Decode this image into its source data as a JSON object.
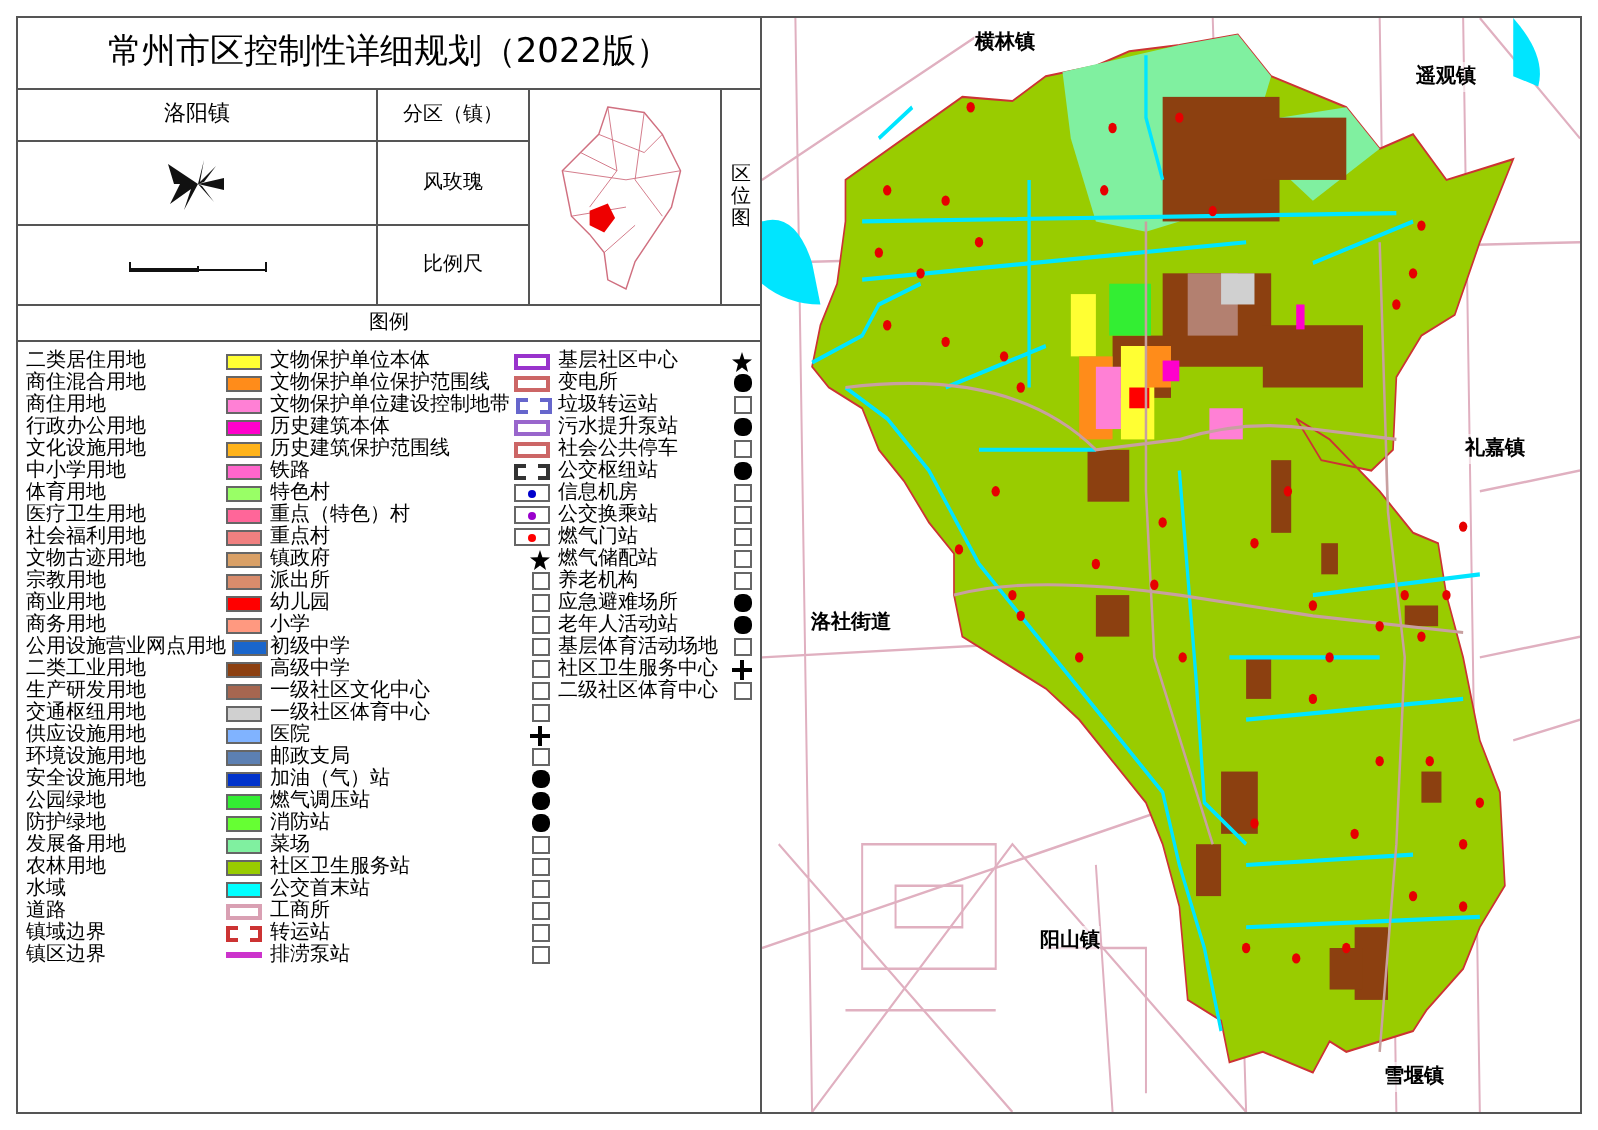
{
  "title": "常州市区控制性详细规划（2022版）",
  "info": {
    "district_label": "分区（镇）",
    "district_value": "洛阳镇",
    "wind_rose_label": "风玫瑰",
    "scale_label": "比例尺",
    "location_label": "区位图"
  },
  "legend": {
    "title": "图例",
    "columns": [
      [
        {
          "label": "二类居住用地",
          "kind": "fill",
          "color": "#ffff33"
        },
        {
          "label": "商住混合用地",
          "kind": "fill",
          "color": "#ff8c1a"
        },
        {
          "label": "商住用地",
          "kind": "fill",
          "color": "#ff80d5"
        },
        {
          "label": "行政办公用地",
          "kind": "fill",
          "color": "#ff00cc"
        },
        {
          "label": "文化设施用地",
          "kind": "fill",
          "color": "#ffb31a"
        },
        {
          "label": "中小学用地",
          "kind": "fill",
          "color": "#ff66cc"
        },
        {
          "label": "体育用地",
          "kind": "fill",
          "color": "#99ff66"
        },
        {
          "label": "医疗卫生用地",
          "kind": "fill",
          "color": "#ff6699"
        },
        {
          "label": "社会福利用地",
          "kind": "fill",
          "color": "#f08080"
        },
        {
          "label": "文物古迹用地",
          "kind": "fill",
          "color": "#d9a066"
        },
        {
          "label": "宗教用地",
          "kind": "fill",
          "color": "#d98c6c"
        },
        {
          "label": "商业用地",
          "kind": "fill",
          "color": "#ff0000"
        },
        {
          "label": "商务用地",
          "kind": "fill",
          "color": "#ff9980"
        },
        {
          "label": "公用设施营业网点用地",
          "kind": "fill",
          "color": "#1a66cc"
        },
        {
          "label": "二类工业用地",
          "kind": "fill",
          "color": "#8c4010"
        },
        {
          "label": "生产研发用地",
          "kind": "fill",
          "color": "#a66650"
        },
        {
          "label": "交通枢纽用地",
          "kind": "fill",
          "color": "#d0d0d0"
        },
        {
          "label": "供应设施用地",
          "kind": "fill",
          "color": "#80b3ff"
        },
        {
          "label": "环境设施用地",
          "kind": "fill",
          "color": "#5c80b3"
        },
        {
          "label": "安全设施用地",
          "kind": "fill",
          "color": "#0033cc"
        },
        {
          "label": "公园绿地",
          "kind": "fill",
          "color": "#33ee33"
        },
        {
          "label": "防护绿地",
          "kind": "fill",
          "color": "#66ff33"
        },
        {
          "label": "发展备用地",
          "kind": "fill",
          "color": "#80f0a0"
        },
        {
          "label": "农林用地",
          "kind": "fill",
          "color": "#99cc00"
        },
        {
          "label": "水域",
          "kind": "fill",
          "color": "#00ffff"
        },
        {
          "label": "道路",
          "kind": "outline",
          "color": "#d9a0b3"
        },
        {
          "label": "镇域边界",
          "kind": "dashed",
          "color": "#cc3333"
        },
        {
          "label": "镇区边界",
          "kind": "line",
          "color": "#cc33cc"
        }
      ],
      [
        {
          "label": "文物保护单位本体",
          "kind": "outline",
          "color": "#9933cc"
        },
        {
          "label": "文物保护单位保护范围线",
          "kind": "outline",
          "color": "#cc6666"
        },
        {
          "label": "文物保护单位建设控制地带",
          "kind": "dashed",
          "color": "#6666cc"
        },
        {
          "label": "历史建筑本体",
          "kind": "outline",
          "color": "#9966cc"
        },
        {
          "label": "历史建筑保护范围线",
          "kind": "outline",
          "color": "#cc6666"
        },
        {
          "label": "铁路",
          "kind": "dashed",
          "color": "#333333"
        },
        {
          "label": "特色村",
          "kind": "dot",
          "color": "#0000cc"
        },
        {
          "label": "重点（特色）村",
          "kind": "dot",
          "color": "#9900cc"
        },
        {
          "label": "重点村",
          "kind": "dot",
          "color": "#ff0000"
        },
        {
          "label": "镇政府",
          "kind": "star",
          "color": "#000000"
        },
        {
          "label": "派出所",
          "kind": "symbol",
          "color": "#666666"
        },
        {
          "label": "幼儿园",
          "kind": "symbol",
          "color": "#666666"
        },
        {
          "label": "小学",
          "kind": "symbol",
          "color": "#666666"
        },
        {
          "label": "初级中学",
          "kind": "symbol",
          "color": "#666666"
        },
        {
          "label": "高级中学",
          "kind": "symbol",
          "color": "#666666"
        },
        {
          "label": "一级社区文化中心",
          "kind": "symbol",
          "color": "#666666"
        },
        {
          "label": "一级社区体育中心",
          "kind": "symbol",
          "color": "#666666"
        },
        {
          "label": "医院",
          "kind": "cross",
          "color": "#000000"
        },
        {
          "label": "邮政支局",
          "kind": "symbol",
          "color": "#666666"
        },
        {
          "label": "加油（气）站",
          "kind": "solid",
          "color": "#000000"
        },
        {
          "label": "燃气调压站",
          "kind": "solid",
          "color": "#000000"
        },
        {
          "label": "消防站",
          "kind": "solid",
          "color": "#000000"
        },
        {
          "label": "菜场",
          "kind": "symbol",
          "color": "#666666"
        },
        {
          "label": "社区卫生服务站",
          "kind": "symbol",
          "color": "#666666"
        },
        {
          "label": "公交首末站",
          "kind": "symbol",
          "color": "#666666"
        },
        {
          "label": "工商所",
          "kind": "symbol",
          "color": "#666666"
        },
        {
          "label": "转运站",
          "kind": "symbol",
          "color": "#666666"
        },
        {
          "label": "排涝泵站",
          "kind": "symbol",
          "color": "#666666"
        }
      ],
      [
        {
          "label": "基层社区中心",
          "kind": "star",
          "color": "#000000"
        },
        {
          "label": "变电所",
          "kind": "solid",
          "color": "#000000"
        },
        {
          "label": "垃圾转运站",
          "kind": "symbol",
          "color": "#666666"
        },
        {
          "label": "污水提升泵站",
          "kind": "solid",
          "color": "#000000"
        },
        {
          "label": "社会公共停车",
          "kind": "symbol",
          "color": "#666666"
        },
        {
          "label": "公交枢纽站",
          "kind": "solid",
          "color": "#000000"
        },
        {
          "label": "信息机房",
          "kind": "symbol",
          "color": "#666666"
        },
        {
          "label": "公交换乘站",
          "kind": "symbol",
          "color": "#666666"
        },
        {
          "label": "燃气门站",
          "kind": "symbol",
          "color": "#666666"
        },
        {
          "label": "燃气储配站",
          "kind": "symbol",
          "color": "#666666"
        },
        {
          "label": "养老机构",
          "kind": "symbol",
          "color": "#666666"
        },
        {
          "label": "应急避难场所",
          "kind": "solid",
          "color": "#000000"
        },
        {
          "label": "老年人活动站",
          "kind": "solid",
          "color": "#000000"
        },
        {
          "label": "基层体育活动场地",
          "kind": "symbol",
          "color": "#666666"
        },
        {
          "label": "社区卫生服务中心",
          "kind": "cross",
          "color": "#000000"
        },
        {
          "label": "二级社区体育中心",
          "kind": "symbol",
          "color": "#666666"
        }
      ]
    ]
  },
  "map": {
    "labels": [
      {
        "text": "横林镇",
        "kind": "top"
      },
      {
        "text": "遥观镇",
        "kind": "topright"
      },
      {
        "text": "礼嘉镇",
        "kind": "right"
      },
      {
        "text": "洛社街道",
        "kind": "left"
      },
      {
        "text": "阳山镇",
        "kind": "bottomleft"
      },
      {
        "text": "雪堰镇",
        "kind": "bottom"
      }
    ]
  }
}
